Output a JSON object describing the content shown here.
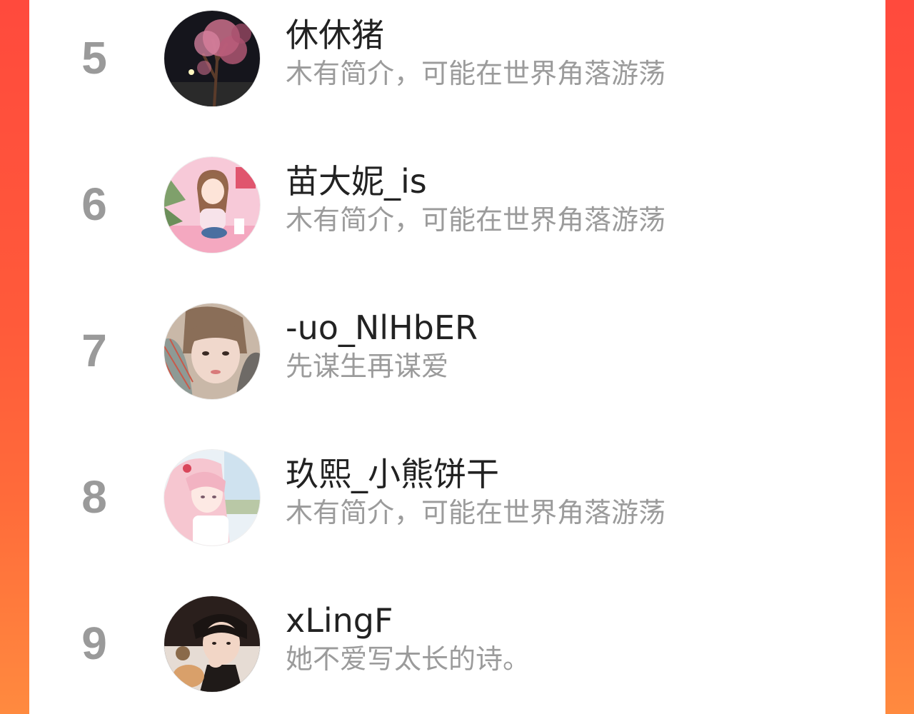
{
  "colors": {
    "background_gradient_top": "#ff4a3d",
    "background_gradient_bottom": "#ff8a3f",
    "panel": "#ffffff",
    "rank_text": "#9a9a9a",
    "name_text": "#222222",
    "bio_text": "#9b9b9b"
  },
  "users": [
    {
      "rank": "5",
      "name": "休休猪",
      "bio": "木有简介，可能在世界角落游荡",
      "avatar": "night-blossom-tree-photo"
    },
    {
      "rank": "6",
      "name": "苗大妮_is",
      "bio": "木有简介，可能在世界角落游荡",
      "avatar": "pink-anime-girl-illustration"
    },
    {
      "rank": "7",
      "name": "-uo_NlHbER",
      "bio": "先谋生再谋爱",
      "avatar": "girl-with-plaid-scarf-photo"
    },
    {
      "rank": "8",
      "name": "玖熙_小熊饼干",
      "bio": "木有简介，可能在世界角落游荡",
      "avatar": "pink-haired-anime-girl-illustration"
    },
    {
      "rank": "9",
      "name": "xLingF",
      "bio": "她不爱写太长的诗。",
      "avatar": "man-with-dog-photo"
    }
  ]
}
